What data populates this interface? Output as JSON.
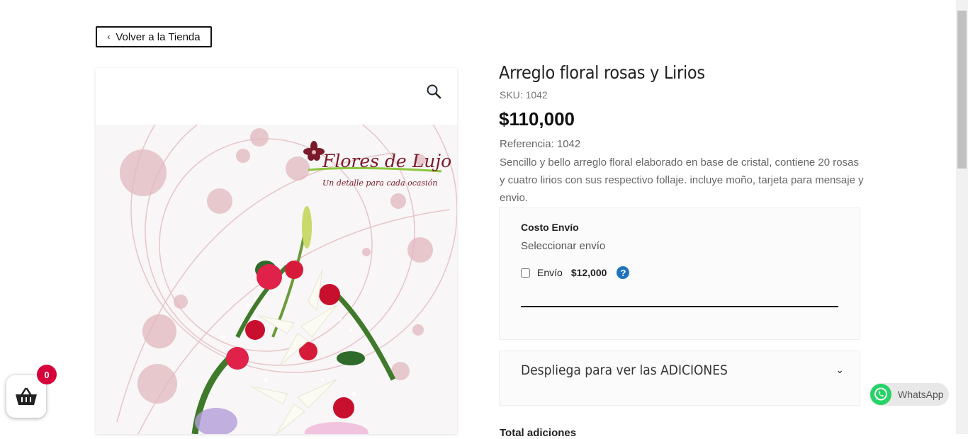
{
  "nav": {
    "back_label": "Volver a la Tienda"
  },
  "product": {
    "title": "Arreglo floral rosas y Lirios",
    "sku": "SKU: 1042",
    "price": "$110,000",
    "reference": "Referencia: 1042",
    "description": "Sencillo y bello arreglo floral elaborado en base de cristal, contiene 20 rosas y cuatro lirios con sus respectivo follaje. incluye moño, tarjeta para mensaje y envio."
  },
  "image": {
    "brand_text": "Flores de Lujo",
    "brand_tagline": "Un detalle para cada ocasión"
  },
  "shipping": {
    "title": "Costo Envío",
    "select_label": "Seleccionar envío",
    "option_label": "Envío",
    "option_price": "$12,000",
    "option_checked": false,
    "help_symbol": "?"
  },
  "addons": {
    "label": "Despliega para ver las ADICIONES"
  },
  "totals": {
    "label": "Total adiciones"
  },
  "cart": {
    "count": "0"
  },
  "whatsapp": {
    "label": "WhatsApp"
  },
  "colors": {
    "badge": "#d6003a",
    "whatsapp_green": "#25d366",
    "help_blue": "#1e73be",
    "brand_maroon": "#7a1a2b"
  }
}
